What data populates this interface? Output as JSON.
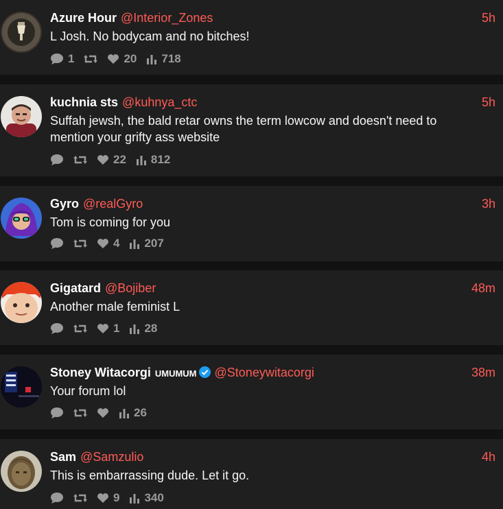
{
  "colors": {
    "background": "#121212",
    "card": "#1f1f1f",
    "accent": "#ff5b56",
    "muted": "#9a9a9a",
    "verified": "#1d9bf0"
  },
  "icons": {
    "reply": "speech-bubble-icon",
    "retweet": "retweet-icon",
    "like": "heart-icon",
    "views": "bar-chart-icon",
    "verified": "verified-check-icon"
  },
  "tweets": [
    {
      "name": "Azure Hour",
      "handle": "@Interior_Zones",
      "time": "5h",
      "text": "L Josh. No bodycam and no bitches!",
      "replies": "1",
      "retweets": "",
      "likes": "20",
      "views": "718"
    },
    {
      "name": "kuchnia sts",
      "handle": "@kuhnya_ctc",
      "time": "5h",
      "text": "Suffah jewsh, the bald retar owns the term lowcow and doesn't need to mention your grifty ass website",
      "replies": "",
      "retweets": "",
      "likes": "22",
      "views": "812"
    },
    {
      "name": "Gyro",
      "handle": "@realGyro",
      "time": "3h",
      "text": "Tom is coming for you",
      "replies": "",
      "retweets": "",
      "likes": "4",
      "views": "207"
    },
    {
      "name": "Gigatard",
      "handle": "@Bojiber",
      "time": "48m",
      "text": "Another male feminist L",
      "replies": "",
      "retweets": "",
      "likes": "1",
      "views": "28"
    },
    {
      "name": "Stoney Witacorgi",
      "badge_text": "UMUMUM",
      "handle": "@Stoneywitacorgi",
      "time": "38m",
      "text": "Your forum lol",
      "replies": "",
      "retweets": "",
      "likes": "",
      "views": "26"
    },
    {
      "name": "Sam",
      "handle": "@Samzulio",
      "time": "4h",
      "text": "This is embarrassing dude. Let it go.",
      "replies": "",
      "retweets": "",
      "likes": "9",
      "views": "340"
    }
  ]
}
